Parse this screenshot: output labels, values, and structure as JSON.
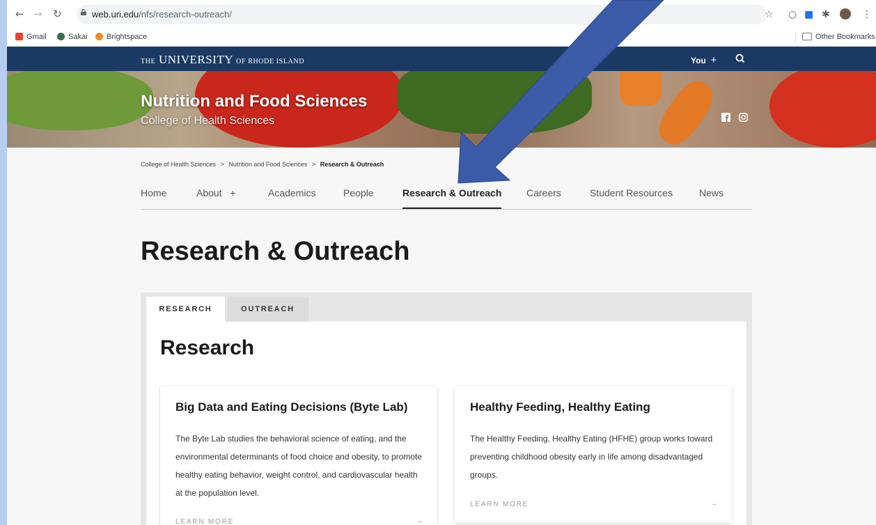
{
  "browser": {
    "url_domain": "web.uri.edu",
    "url_path": "/nfs/research-outreach/",
    "bookmarks": [
      "Gmail",
      "Sakai",
      "Brightspace"
    ],
    "other_bookmarks": "Other Bookmarks"
  },
  "header": {
    "logo_the": "THE",
    "logo_university": "UNIVERSITY",
    "logo_of": "OF RHODE ISLAND",
    "you_label": "You",
    "plus": "+"
  },
  "banner": {
    "department": "Nutrition and Food Sciences",
    "college": "College of Health Sciences"
  },
  "breadcrumb": [
    "College of Health Sciences",
    "Nutrition and Food Sciences",
    "Research & Outreach"
  ],
  "breadcrumb_sep": ">",
  "menu": [
    "Home",
    "About",
    "Academics",
    "People",
    "Research & Outreach",
    "Careers",
    "Student Resources",
    "News"
  ],
  "page_title": "Research & Outreach",
  "tabs": [
    "RESEARCH",
    "OUTREACH"
  ],
  "section_title": "Research",
  "cards": [
    {
      "title": "Big Data and Eating Decisions (Byte Lab)",
      "body": "The Byte Lab studies the behavioral science of eating, and the environmental determinants of food choice and obesity, to promote healthy eating behavior, weight control, and cardiovascular health at the population level.",
      "link": "LEARN MORE"
    },
    {
      "title": "Healthy Feeding, Healthy Eating",
      "body": "The Healthy Feeding, Healthy Eating (HFHE) group works toward preventing childhood obesity early in life among disadvantaged groups.",
      "link": "LEARN MORE"
    }
  ],
  "colors": {
    "uri_navy": "#1a3a63",
    "annotation_arrow": "#3b5aa8"
  }
}
